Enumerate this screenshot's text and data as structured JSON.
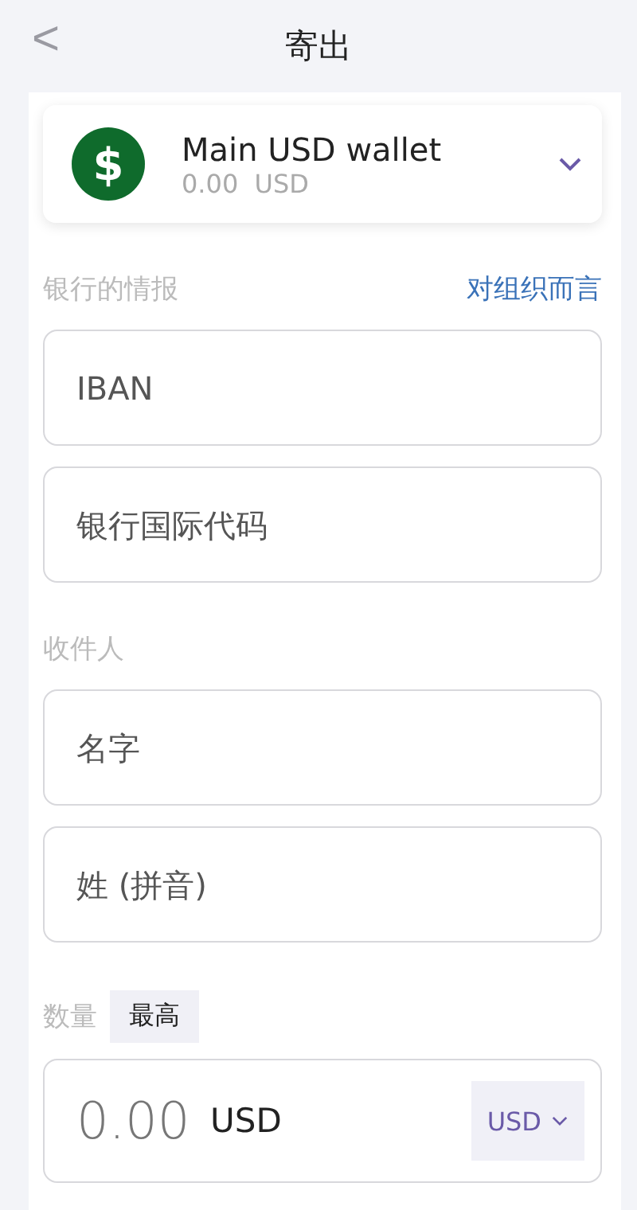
{
  "header": {
    "back": "<",
    "title": "寄出"
  },
  "wallet": {
    "name": "Main USD wallet",
    "balance": "0.00  USD",
    "symbol": "$"
  },
  "bank": {
    "label": "银行的情报",
    "link": "对组织而言",
    "fields": [
      {
        "placeholder": "IBAN"
      },
      {
        "placeholder": "银行国际代码"
      }
    ]
  },
  "recipient": {
    "label": "收件人",
    "fields": [
      {
        "placeholder": "名字"
      },
      {
        "placeholder": "姓 (拼音)"
      }
    ]
  },
  "amount": {
    "label": "数量",
    "max_button": "最高",
    "placeholder": "0.00",
    "unit": "USD",
    "currency": "USD"
  }
}
